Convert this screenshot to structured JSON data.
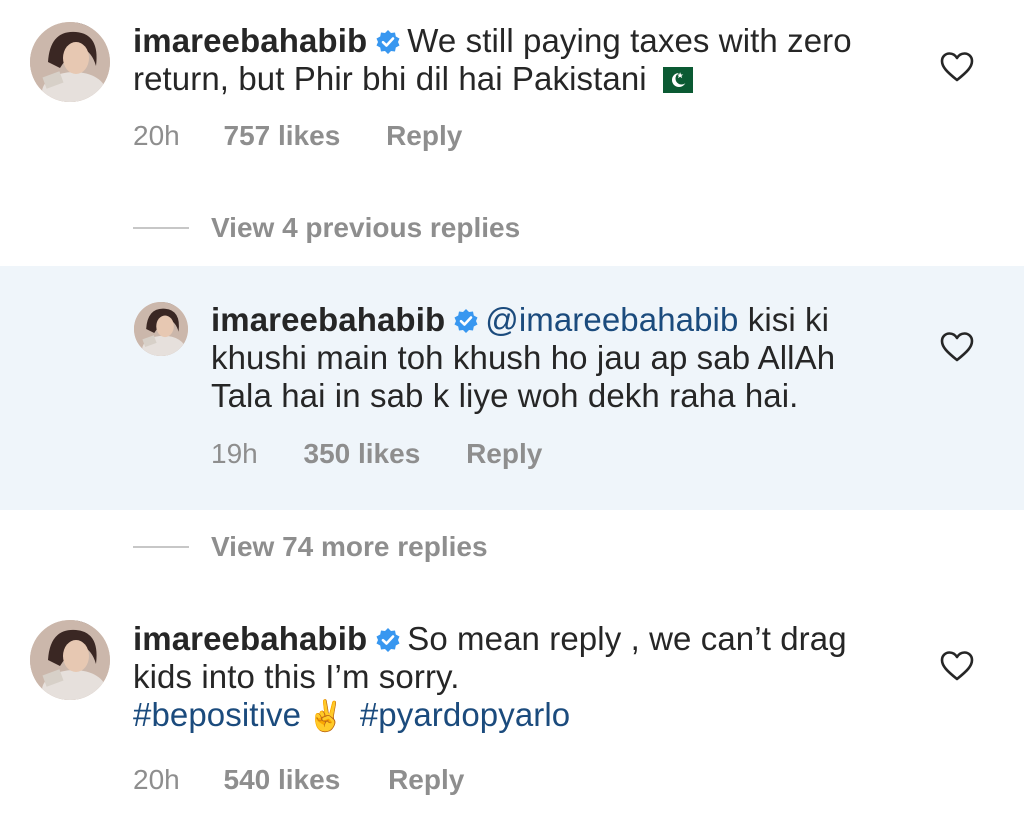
{
  "comments": [
    {
      "username": "imareebahabib",
      "text": "We still paying taxes with zero return, but Phir bhi dil hai Pakistani",
      "flag_emoji": "pakistan-flag",
      "time": "20h",
      "likes": "757 likes",
      "reply": "Reply"
    },
    {
      "username": "imareebahabib",
      "mention": "@imareebahabib",
      "text": "kisi ki khushi main toh khush ho jau ap sab AllAh Tala hai in sab k liye woh dekh raha hai.",
      "time": "19h",
      "likes": "350 likes",
      "reply": "Reply"
    },
    {
      "username": "imareebahabib",
      "text": "So mean reply , we can’t drag kids into this I’m sorry.",
      "hashtag1": "#bepositive",
      "peace_emoji": "✌️",
      "hashtag2": "#pyardopyarlo",
      "time": "20h",
      "likes": "540 likes",
      "reply": "Reply"
    }
  ],
  "view_previous": "View 4 previous replies",
  "view_more": "View 74 more replies",
  "colors": {
    "highlight_bg": "#eff5fa",
    "link": "#1b4b7d",
    "muted": "#8e8e8e",
    "verified": "#3897f0"
  }
}
